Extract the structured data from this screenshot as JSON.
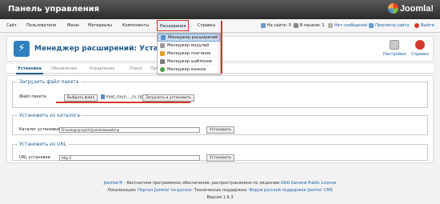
{
  "header": {
    "title": "Панель управления",
    "logo_text": "Joomla!"
  },
  "menu": {
    "items": [
      "Сайт",
      "Пользователи",
      "Меню",
      "Материалы",
      "Компоненты",
      "Расширения",
      "Справка"
    ],
    "active": "Расширения"
  },
  "status": {
    "on_site": "На сайте: 0",
    "in_panel": "В панели: 1",
    "messages": "Нет сообщений",
    "preview": "Просмотр сайта",
    "logout": "Выйти"
  },
  "dropdown": {
    "items": [
      {
        "label": "Менеджер расширений",
        "icon": "extension-icon",
        "selected": true
      },
      {
        "label": "Менеджер модулей",
        "icon": "module-icon",
        "selected": false
      },
      {
        "label": "Менеджер плагинов",
        "icon": "plugin-icon",
        "selected": false
      },
      {
        "label": "Менеджер шаблонов",
        "icon": "template-icon",
        "selected": false
      },
      {
        "label": "Менеджер языков",
        "icon": "language-icon",
        "selected": false
      }
    ]
  },
  "page": {
    "title": "Менеджер расширений: Установк",
    "toolbar": {
      "settings": "Настройки",
      "help": "Справка"
    },
    "tabs": [
      "Установка",
      "Обновление",
      "Управление",
      "Поиск",
      "Предупреждения"
    ],
    "active_tab": "Установка"
  },
  "upload": {
    "legend": "Загрузить файл пакета",
    "label": "Файл пакета",
    "choose_button": "Выбрать файл",
    "file_name": "mod_coun..._ru.zip",
    "install_button": "Загрузить и установить"
  },
  "directory": {
    "legend": "Установить из каталога",
    "label": "Каталог установки",
    "value": "D:\\xampp\\projects\\joomla\\www\\tmp",
    "button": "Установить"
  },
  "url": {
    "legend": "Установить из URL",
    "label": "URL установки",
    "value": "http://",
    "button": "Установить"
  },
  "footer": {
    "line1_link": "Joomla!®",
    "line1_text": " - бесплатное программное обеспечение, распространяемое по лицензии ",
    "line1_link2": "GNU General Public License",
    "line2_text": "Локализация: ",
    "line2_link": "Портал Joomla! по-русски",
    "line2_text2": ". Техническая поддержка: ",
    "line2_link2": "Форум русской поддержки Joomla! CMS",
    "version": "Версия 1.6.3"
  },
  "colors": {
    "accent": "#1f5a8c",
    "highlight": "#d0392c",
    "link": "#1a5ea8"
  }
}
